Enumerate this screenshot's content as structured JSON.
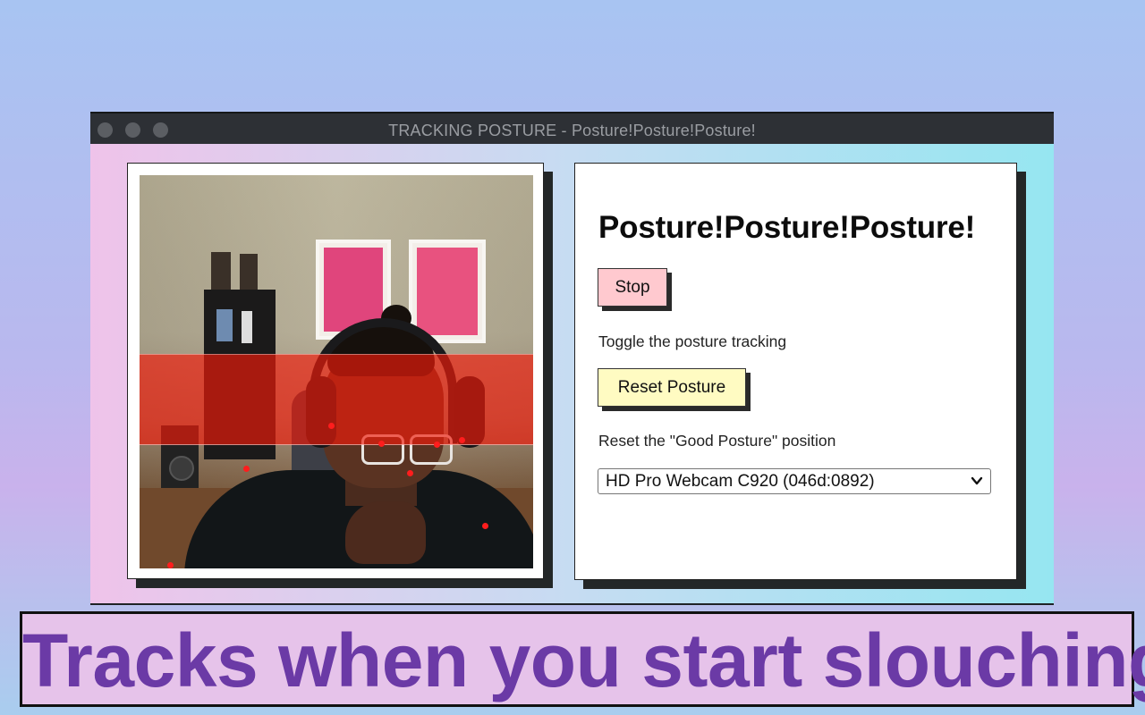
{
  "window": {
    "title": "TRACKING POSTURE - Posture!Posture!Posture!"
  },
  "panel": {
    "heading": "Posture!Posture!Posture!",
    "stop_label": "Stop",
    "stop_help": "Toggle the posture tracking",
    "reset_label": "Reset Posture",
    "reset_help": "Reset the \"Good Posture\" position",
    "camera_selected": "HD Pro Webcam C920 (046d:0892)"
  },
  "caption": "Tracks when you start slouching!",
  "colors": {
    "stop_button": "#ffc9cf",
    "reset_button": "#fffbc2",
    "caption_text": "#6b3aa6",
    "caption_bg": "#e6c3ea",
    "slouch_band": "#f21c0a"
  },
  "icons": {
    "titlebar_buttons": [
      "window-close-icon",
      "window-minimize-icon",
      "window-zoom-icon"
    ],
    "select_arrow": "chevron-down-icon"
  }
}
